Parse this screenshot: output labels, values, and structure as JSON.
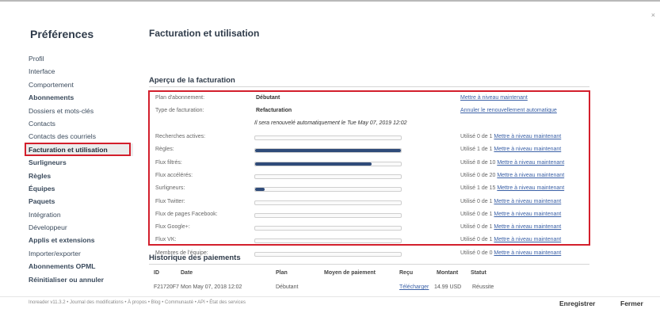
{
  "sidebar": {
    "title": "Préférences",
    "items": [
      {
        "label": "Profil",
        "bold": false
      },
      {
        "label": "Interface",
        "bold": false
      },
      {
        "label": "Comportement",
        "bold": false
      },
      {
        "label": "Abonnements",
        "bold": true
      },
      {
        "label": "Dossiers et mots-clés",
        "bold": false
      },
      {
        "label": "Contacts",
        "bold": false
      },
      {
        "label": "Contacts des courriels",
        "bold": false
      },
      {
        "label": "Facturation et utilisation",
        "bold": true,
        "active": true
      },
      {
        "label": "Surligneurs",
        "bold": true
      },
      {
        "label": "Règles",
        "bold": true
      },
      {
        "label": "Équipes",
        "bold": true
      },
      {
        "label": "Paquets",
        "bold": true
      },
      {
        "label": "Intégration",
        "bold": false
      },
      {
        "label": "Développeur",
        "bold": false
      },
      {
        "label": "Applis et extensions",
        "bold": true
      },
      {
        "label": "Importer/exporter",
        "bold": false
      },
      {
        "label": "Abonnements OPML",
        "bold": true
      },
      {
        "label": "Réinitialiser ou annuler",
        "bold": true
      }
    ]
  },
  "main": {
    "title": "Facturation et utilisation",
    "overview_title": "Aperçu de la facturation",
    "plan_label": "Plan d'abonnement:",
    "plan_value": "Débutant",
    "plan_action": "Mettre à niveau maintenant",
    "billing_type_label": "Type de facturation:",
    "billing_type_value": "Refacturation",
    "billing_type_action": "Annuler le renouvellement automatique",
    "renewal_note": "Il sera renouvelé automatiquement le Tue May 07, 2019 12:02",
    "upgrade_link": "Mettre à niveau maintenant",
    "usage": [
      {
        "label": "Recherches actives:",
        "used": 0,
        "total": 1,
        "status": "Utilisé 0 de 1"
      },
      {
        "label": "Règles:",
        "used": 1,
        "total": 1,
        "status": "Utilisé 1 de 1"
      },
      {
        "label": "Flux filtrés:",
        "used": 8,
        "total": 10,
        "status": "Utilisé 8 de 10"
      },
      {
        "label": "Flux accélérés:",
        "used": 0,
        "total": 20,
        "status": "Utilisé 0 de 20"
      },
      {
        "label": "Surligneurs:",
        "used": 1,
        "total": 15,
        "status": "Utilisé 1 de 15"
      },
      {
        "label": "Flux Twitter:",
        "used": 0,
        "total": 1,
        "status": "Utilisé 0 de 1"
      },
      {
        "label": "Flux de pages Facebook:",
        "used": 0,
        "total": 1,
        "status": "Utilisé 0 de 1"
      },
      {
        "label": "Flux Google+:",
        "used": 0,
        "total": 1,
        "status": "Utilisé 0 de 1"
      },
      {
        "label": "Flux VK:",
        "used": 0,
        "total": 1,
        "status": "Utilisé 0 de 1"
      },
      {
        "label": "Membres de l'équipe:",
        "used": 0,
        "total": 0,
        "status": "Utilisé 0 de 0"
      }
    ],
    "history_title": "Historique des paiements",
    "history_headers": [
      "ID",
      "Date",
      "Plan",
      "Moyen de paiement",
      "Reçu",
      "Montant",
      "Statut"
    ],
    "history_rows": [
      [
        "F21720F7",
        "Mon May 07, 2018 12:02",
        "Débutant",
        "",
        "Télécharger",
        "14.99 USD",
        "Réussite"
      ]
    ]
  },
  "footer": {
    "version": "Inoreader v11.3.2 • Journal des modifications • À propos • Blog • Communauté • API • État des services",
    "save_label": "Enregistrer",
    "close_label": "Fermer"
  },
  "colors": {
    "accent_red": "#d31f2c",
    "bar_fill": "#2f4b79",
    "link": "#3b61a7"
  }
}
